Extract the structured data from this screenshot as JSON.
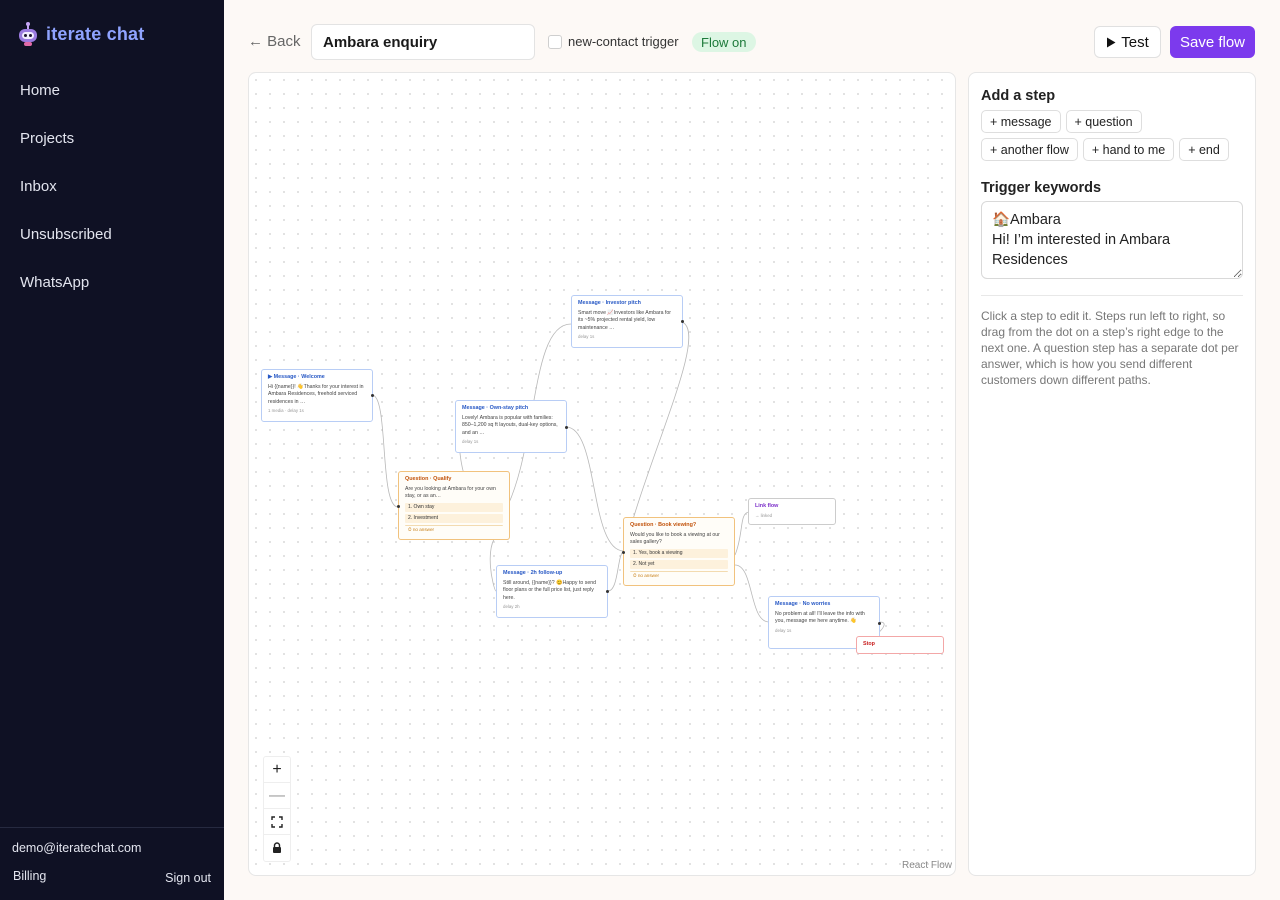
{
  "brand": {
    "name": "iterate chat",
    "accent": "#8fa3ff"
  },
  "nav": [
    "Home",
    "Projects",
    "Inbox",
    "Unsubscribed",
    "WhatsApp"
  ],
  "account": {
    "email": "demo@iteratechat.com",
    "billing": "Billing",
    "signout": "Sign out"
  },
  "topbar": {
    "back": "← Back",
    "flow_name": "Ambara enquiry",
    "trigger_label": "new-contact trigger",
    "status": "Flow on",
    "test_label": "Test",
    "save_label": "Save flow",
    "save_color": "#7c3aed"
  },
  "canvas": {
    "attribution": "React Flow",
    "zoom_controls": [
      "+",
      "—",
      "⛶",
      "🔒"
    ],
    "nodes": {
      "welcome": {
        "head": "▶ Message · Welcome",
        "body": "Hi {{name}}! 👋Thanks for your interest in Ambara Residences, freehold serviced residences in …",
        "foot": "1 media · delay 1s"
      },
      "qualify": {
        "head": "Question · Qualify",
        "body": "Are you looking at Ambara for your own stay, or as an…",
        "options": [
          "1. Own stay",
          "2. Investment"
        ],
        "no_answer": "⏱ no answer"
      },
      "ownstay": {
        "head": "Message · Own-stay pitch",
        "body": "Lovely! Ambara is popular with families: 850–1,200 sq ft layouts, dual-key options, and an …",
        "foot": "delay 1s"
      },
      "investor": {
        "head": "Message · Investor pitch",
        "body": "Smart move 📈Investors like Ambara for its ~5% projected rental yield, low maintenance …",
        "foot": "delay 1s"
      },
      "followup": {
        "head": "Message · 2h follow-up",
        "body": "Still around, {{name}}? 😊Happy to send floor plans or the full price list, just reply here.",
        "foot": "delay 2h"
      },
      "booking": {
        "head": "Question · Book viewing?",
        "body": "Would you like to book a viewing at our sales gallery?",
        "options": [
          "1. Yes, book a viewing",
          "2. Not yet"
        ],
        "no_answer": "⏱ no answer"
      },
      "linkflow": {
        "head": "Link flow",
        "foot": "→ linked"
      },
      "noworries": {
        "head": "Message · No worries",
        "body": "No problem at all! I'll leave the info with you, message me here anytime. 👋",
        "foot": "delay 1s"
      },
      "stop": {
        "head": "Stop"
      }
    }
  },
  "panel": {
    "add_step_title": "Add a step",
    "steps_row1": [
      "+ message",
      "+ question"
    ],
    "steps_row2": [
      "+ another flow",
      "+ hand to me",
      "+ end"
    ],
    "trigger_title": "Trigger keywords",
    "keywords": "🏠Ambara\nHi! I’m interested in Ambara Residences",
    "help": "Click a step to edit it. Steps run left to right, so drag from the dot on a step’s right edge to the next one. A question step has a separate dot per answer, which is how you send different customers down different paths."
  }
}
